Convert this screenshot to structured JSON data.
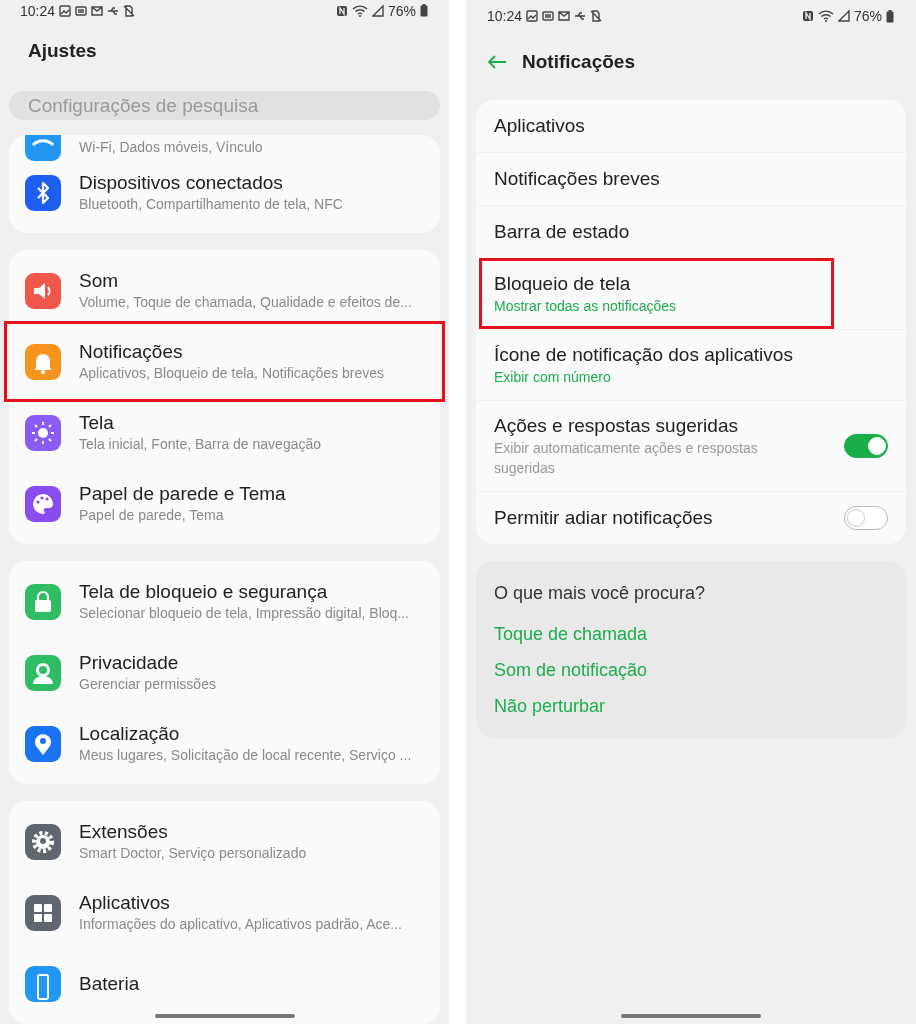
{
  "settings_screen": {
    "status_bar": {
      "time": "10:24",
      "battery": "76%"
    },
    "title": "Ajustes",
    "search": {
      "placeholder": "Configurações de pesquisa"
    },
    "groups": [
      {
        "items": [
          {
            "kind": "wifi",
            "color": "#2196f3",
            "subtitle": "Wi-Fi, Dados móveis, Vínculo",
            "highlighted": false
          },
          {
            "kind": "bluetooth",
            "color": "#1d5ff0",
            "title": "Dispositivos conectados",
            "subtitle": "Bluetooth, Compartilhamento de tela, NFC",
            "highlighted": false
          }
        ]
      },
      {
        "items": [
          {
            "kind": "sound",
            "color": "#f0564a",
            "title": "Som",
            "subtitle": "Volume, Toque de chamada, Qualidade e efeitos de...",
            "highlighted": false
          },
          {
            "kind": "bell",
            "color": "#f7941d",
            "title": "Notificações",
            "subtitle": "Aplicativos, Bloqueio de tela, Notificações breves",
            "highlighted": true
          },
          {
            "kind": "sun",
            "color": "#8a5cf5",
            "title": "Tela",
            "subtitle": "Tela inicial, Fonte, Barra de navegação",
            "highlighted": false
          },
          {
            "kind": "palette",
            "color": "#8a4cf0",
            "title": "Papel de parede e Tema",
            "subtitle": "Papel de parede, Tema",
            "highlighted": false
          }
        ]
      },
      {
        "items": [
          {
            "kind": "lock",
            "color": "#2fbd63",
            "title": "Tela de bloqueio e segurança",
            "subtitle": "Selecionar bloqueio de tela, Impressão digital, Bloq...",
            "highlighted": false
          },
          {
            "kind": "person",
            "color": "#2fbd63",
            "title": "Privacidade",
            "subtitle": "Gerenciar permissões",
            "highlighted": false
          },
          {
            "kind": "pin",
            "color": "#1a73f0",
            "title": "Localização",
            "subtitle": "Meus lugares, Solicitação de local recente, Serviço ...",
            "highlighted": false
          }
        ]
      },
      {
        "items": [
          {
            "kind": "gear",
            "color": "#5f6670",
            "title": "Extensões",
            "subtitle": "Smart Doctor, Serviço personalizado",
            "highlighted": false
          },
          {
            "kind": "grid",
            "color": "#5f6670",
            "title": "Aplicativos",
            "subtitle": "Informações do aplicativo, Aplicativos padrão, Ace...",
            "highlighted": false
          },
          {
            "kind": "battery",
            "color": "#2196f3",
            "title": "Bateria",
            "highlighted": false
          }
        ]
      }
    ]
  },
  "notifications_screen": {
    "status_bar": {
      "time": "10:24",
      "battery": "76%"
    },
    "title": "Notificações",
    "items": [
      {
        "kind": "link",
        "title": "Aplicativos",
        "highlighted": false
      },
      {
        "kind": "link",
        "title": "Notificações breves",
        "highlighted": false
      },
      {
        "kind": "link",
        "title": "Barra de estado",
        "highlighted": false
      },
      {
        "kind": "value",
        "title": "Bloqueio de tela",
        "subtitle": "Mostrar todas as notificações",
        "highlighted": true
      },
      {
        "kind": "value",
        "title": "Ícone de notificação dos aplicativos",
        "subtitle": "Exibir com número",
        "highlighted": false
      },
      {
        "kind": "toggle",
        "title": "Ações e respostas sugeridas",
        "subtitle": "Exibir automaticamente ações e respostas sugeridas",
        "on": true,
        "highlighted": false
      },
      {
        "kind": "toggle",
        "title": "Permitir adiar notificações",
        "on": false,
        "highlighted": false
      }
    ],
    "suggestions": {
      "title": "O que mais você procura?",
      "links": [
        "Toque de chamada",
        "Som de notificação",
        "Não perturbar"
      ]
    }
  }
}
